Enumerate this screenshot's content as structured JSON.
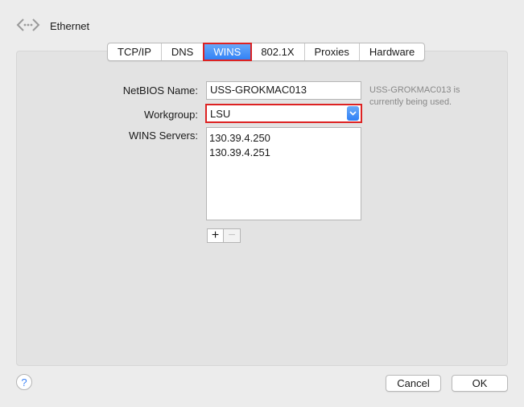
{
  "header": {
    "title": "Ethernet",
    "icon": "network-arrows-icon"
  },
  "tabs": [
    {
      "label": "TCP/IP"
    },
    {
      "label": "DNS"
    },
    {
      "label": "WINS",
      "selected": true
    },
    {
      "label": "802.1X"
    },
    {
      "label": "Proxies"
    },
    {
      "label": "Hardware"
    }
  ],
  "form": {
    "netbios_label": "NetBIOS Name:",
    "netbios_value": "USS-GROKMAC013",
    "netbios_note": "USS-GROKMAC013 is currently being used.",
    "workgroup_label": "Workgroup:",
    "workgroup_value": "LSU",
    "wins_label": "WINS Servers:",
    "wins_servers": [
      "130.39.4.250",
      "130.39.4.251"
    ],
    "add_label": "+",
    "remove_label": "−"
  },
  "footer": {
    "help_label": "?",
    "cancel_label": "Cancel",
    "ok_label": "OK"
  },
  "colors": {
    "accent": "#2f80f6",
    "highlight": "#dd2222"
  }
}
